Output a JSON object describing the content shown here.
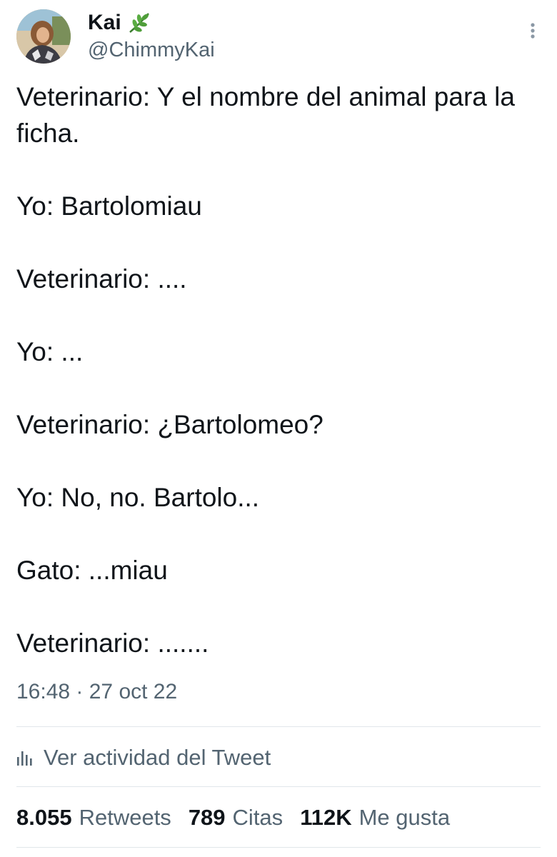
{
  "author": {
    "display_name": "Kai",
    "name_emoji_icon": "herb-leaf-icon",
    "handle": "@ChimmyKai"
  },
  "tweet": {
    "lines": [
      "Veterinario: Y el nombre del animal para la ficha.",
      "Yo: Bartolomiau",
      "Veterinario: ....",
      "Yo: ...",
      "Veterinario: ¿Bartolomeo?",
      "Yo: No, no. Bartolo...",
      "Gato: ...miau",
      "Veterinario: ......."
    ],
    "timestamp": "16:48 · 27 oct 22"
  },
  "activity": {
    "label": "Ver actividad del Tweet",
    "icon": "bar-chart-icon"
  },
  "stats": {
    "retweets_count": "8.055",
    "retweets_label": "Retweets",
    "quotes_count": "789",
    "quotes_label": "Citas",
    "likes_count": "112K",
    "likes_label": "Me gusta"
  },
  "colors": {
    "primary_text": "#0f1419",
    "secondary_text": "#536471",
    "divider": "#e1e6ea",
    "leaf_green": "#3a8f3a"
  }
}
